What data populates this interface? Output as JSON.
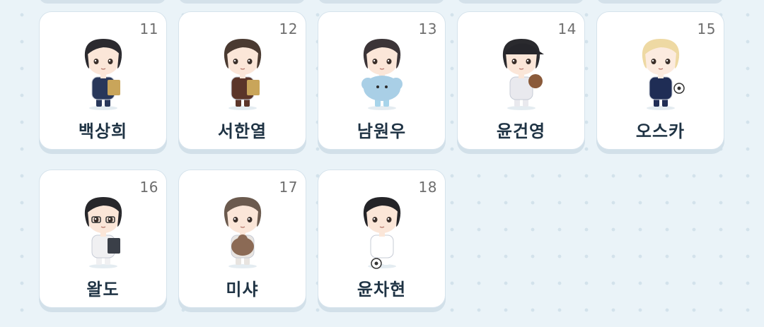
{
  "grid": {
    "cards": [
      {
        "number": "11",
        "name": "백상희",
        "hair": "#2b2a2f",
        "outfit": "#28375a",
        "skin": "#fbe6d8",
        "prop": "book",
        "cap": false,
        "glasses": false
      },
      {
        "number": "12",
        "name": "서한열",
        "hair": "#4a3a31",
        "outfit": "#5b3529",
        "skin": "#fbe6d8",
        "prop": "book",
        "cap": false,
        "glasses": false
      },
      {
        "number": "13",
        "name": "남원우",
        "hair": "#3b3437",
        "outfit": "#a7d4ea",
        "skin": "#fbe6d8",
        "prop": "plush",
        "cap": false,
        "glasses": false
      },
      {
        "number": "14",
        "name": "윤건영",
        "hair": "#2a2a2e",
        "outfit": "#e9e9ee",
        "skin": "#fbe6d8",
        "prop": "glove",
        "cap": true,
        "glasses": false
      },
      {
        "number": "15",
        "name": "오스카",
        "hair": "#eed9a3",
        "outfit": "#1f2d55",
        "skin": "#fcebdf",
        "prop": "ball",
        "cap": false,
        "glasses": false
      },
      {
        "number": "16",
        "name": "왈도",
        "hair": "#27272b",
        "outfit": "#f0f0f2",
        "skin": "#fbe6d8",
        "prop": "notebook",
        "cap": false,
        "glasses": true
      },
      {
        "number": "17",
        "name": "미샤",
        "hair": "#6b5a4e",
        "outfit": "#e8e4e0",
        "skin": "#fbe6d8",
        "prop": "plush-dog",
        "cap": false,
        "glasses": false
      },
      {
        "number": "18",
        "name": "윤차현",
        "hair": "#242428",
        "outfit": "#ffffff",
        "skin": "#fbe6d8",
        "prop": "soccer",
        "cap": false,
        "glasses": false
      }
    ]
  }
}
